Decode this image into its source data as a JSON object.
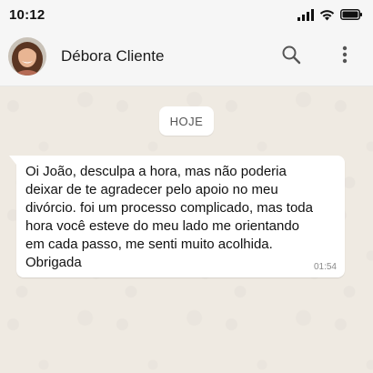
{
  "status_bar": {
    "time": "10:12",
    "icons": [
      "signal-icon",
      "wifi-icon",
      "battery-icon"
    ]
  },
  "header": {
    "contact_name": "Débora Cliente",
    "icons": [
      "back-avatar",
      "search-icon",
      "more-vert-icon"
    ]
  },
  "chat": {
    "date_label": "HOJE",
    "messages": [
      {
        "text": "Oi João, desculpa a hora, mas não poderia deixar de te agradecer pelo apoio no meu divórcio. foi um processo complicado, mas toda hora você esteve do meu lado me orientando em cada passo, me senti muito acolhida. Obrigada",
        "time": "01:54",
        "direction": "incoming"
      }
    ]
  },
  "colors": {
    "chat_background": "#efeae2",
    "header_background": "#f6f6f6",
    "bubble_background": "#ffffff"
  }
}
